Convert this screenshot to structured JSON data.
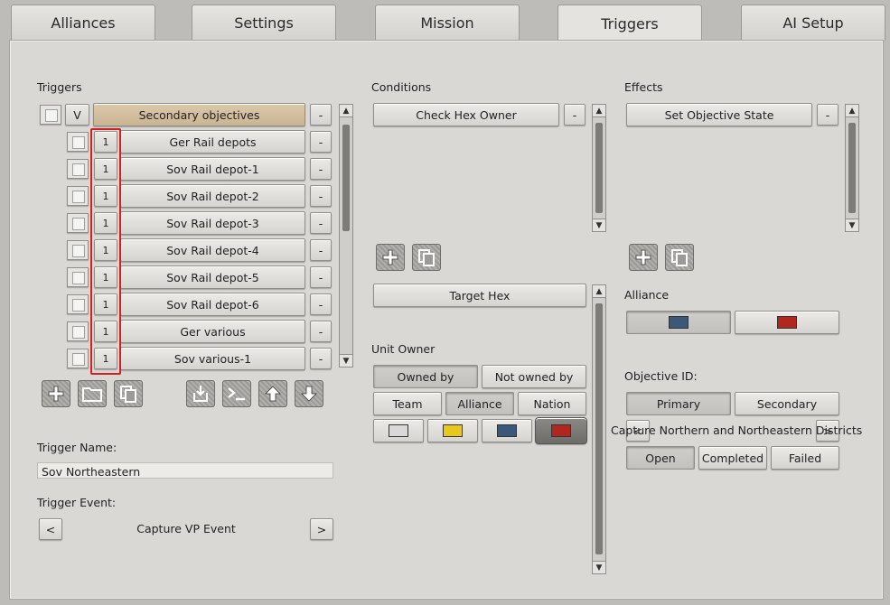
{
  "tabs": [
    "Alliances",
    "Settings",
    "Mission",
    "Triggers",
    "AI Setup"
  ],
  "triggers": {
    "title": "Triggers",
    "header_check": "V",
    "header_label": "Secondary objectives",
    "remove_label": "-",
    "items": [
      {
        "num": "1",
        "label": "Ger Rail depots"
      },
      {
        "num": "1",
        "label": "Sov Rail depot-1"
      },
      {
        "num": "1",
        "label": "Sov Rail depot-2"
      },
      {
        "num": "1",
        "label": "Sov Rail depot-3"
      },
      {
        "num": "1",
        "label": "Sov Rail depot-4"
      },
      {
        "num": "1",
        "label": "Sov Rail depot-5"
      },
      {
        "num": "1",
        "label": "Sov Rail depot-6"
      },
      {
        "num": "1",
        "label": "Ger various"
      },
      {
        "num": "1",
        "label": "Sov various-1"
      }
    ],
    "toolbar_icons": [
      "add-icon",
      "folder-icon",
      "copy-icon",
      "import-icon",
      "console-icon",
      "arrow-up-icon",
      "arrow-down-icon"
    ],
    "name_label": "Trigger Name:",
    "name_value": "Sov Northeastern",
    "event_label": "Trigger Event:",
    "event_value": "Capture VP Event",
    "prev": "<",
    "next": ">"
  },
  "conditions": {
    "title": "Conditions",
    "item": "Check Hex Owner",
    "remove_label": "-",
    "target_hex": "Target Hex",
    "unit_owner_label": "Unit Owner",
    "owned_by": "Owned by",
    "not_owned_by": "Not owned by",
    "team": "Team",
    "alliance": "Alliance",
    "nation": "Nation",
    "colors": [
      "#d9d9d9",
      "#e8c81a",
      "#3c5878",
      "#b3261e"
    ]
  },
  "effects": {
    "title": "Effects",
    "item": "Set Objective State",
    "remove_label": "-",
    "alliance_label": "Alliance",
    "alliance_colors": [
      "#3c5878",
      "#b3261e"
    ],
    "objective_label": "Objective ID:",
    "primary": "Primary",
    "secondary": "Secondary",
    "objective_prev": "<",
    "objective_name": "Capture Northern and Northeastern Districts",
    "objective_next": ">",
    "open": "Open",
    "completed": "Completed",
    "failed": "Failed"
  }
}
